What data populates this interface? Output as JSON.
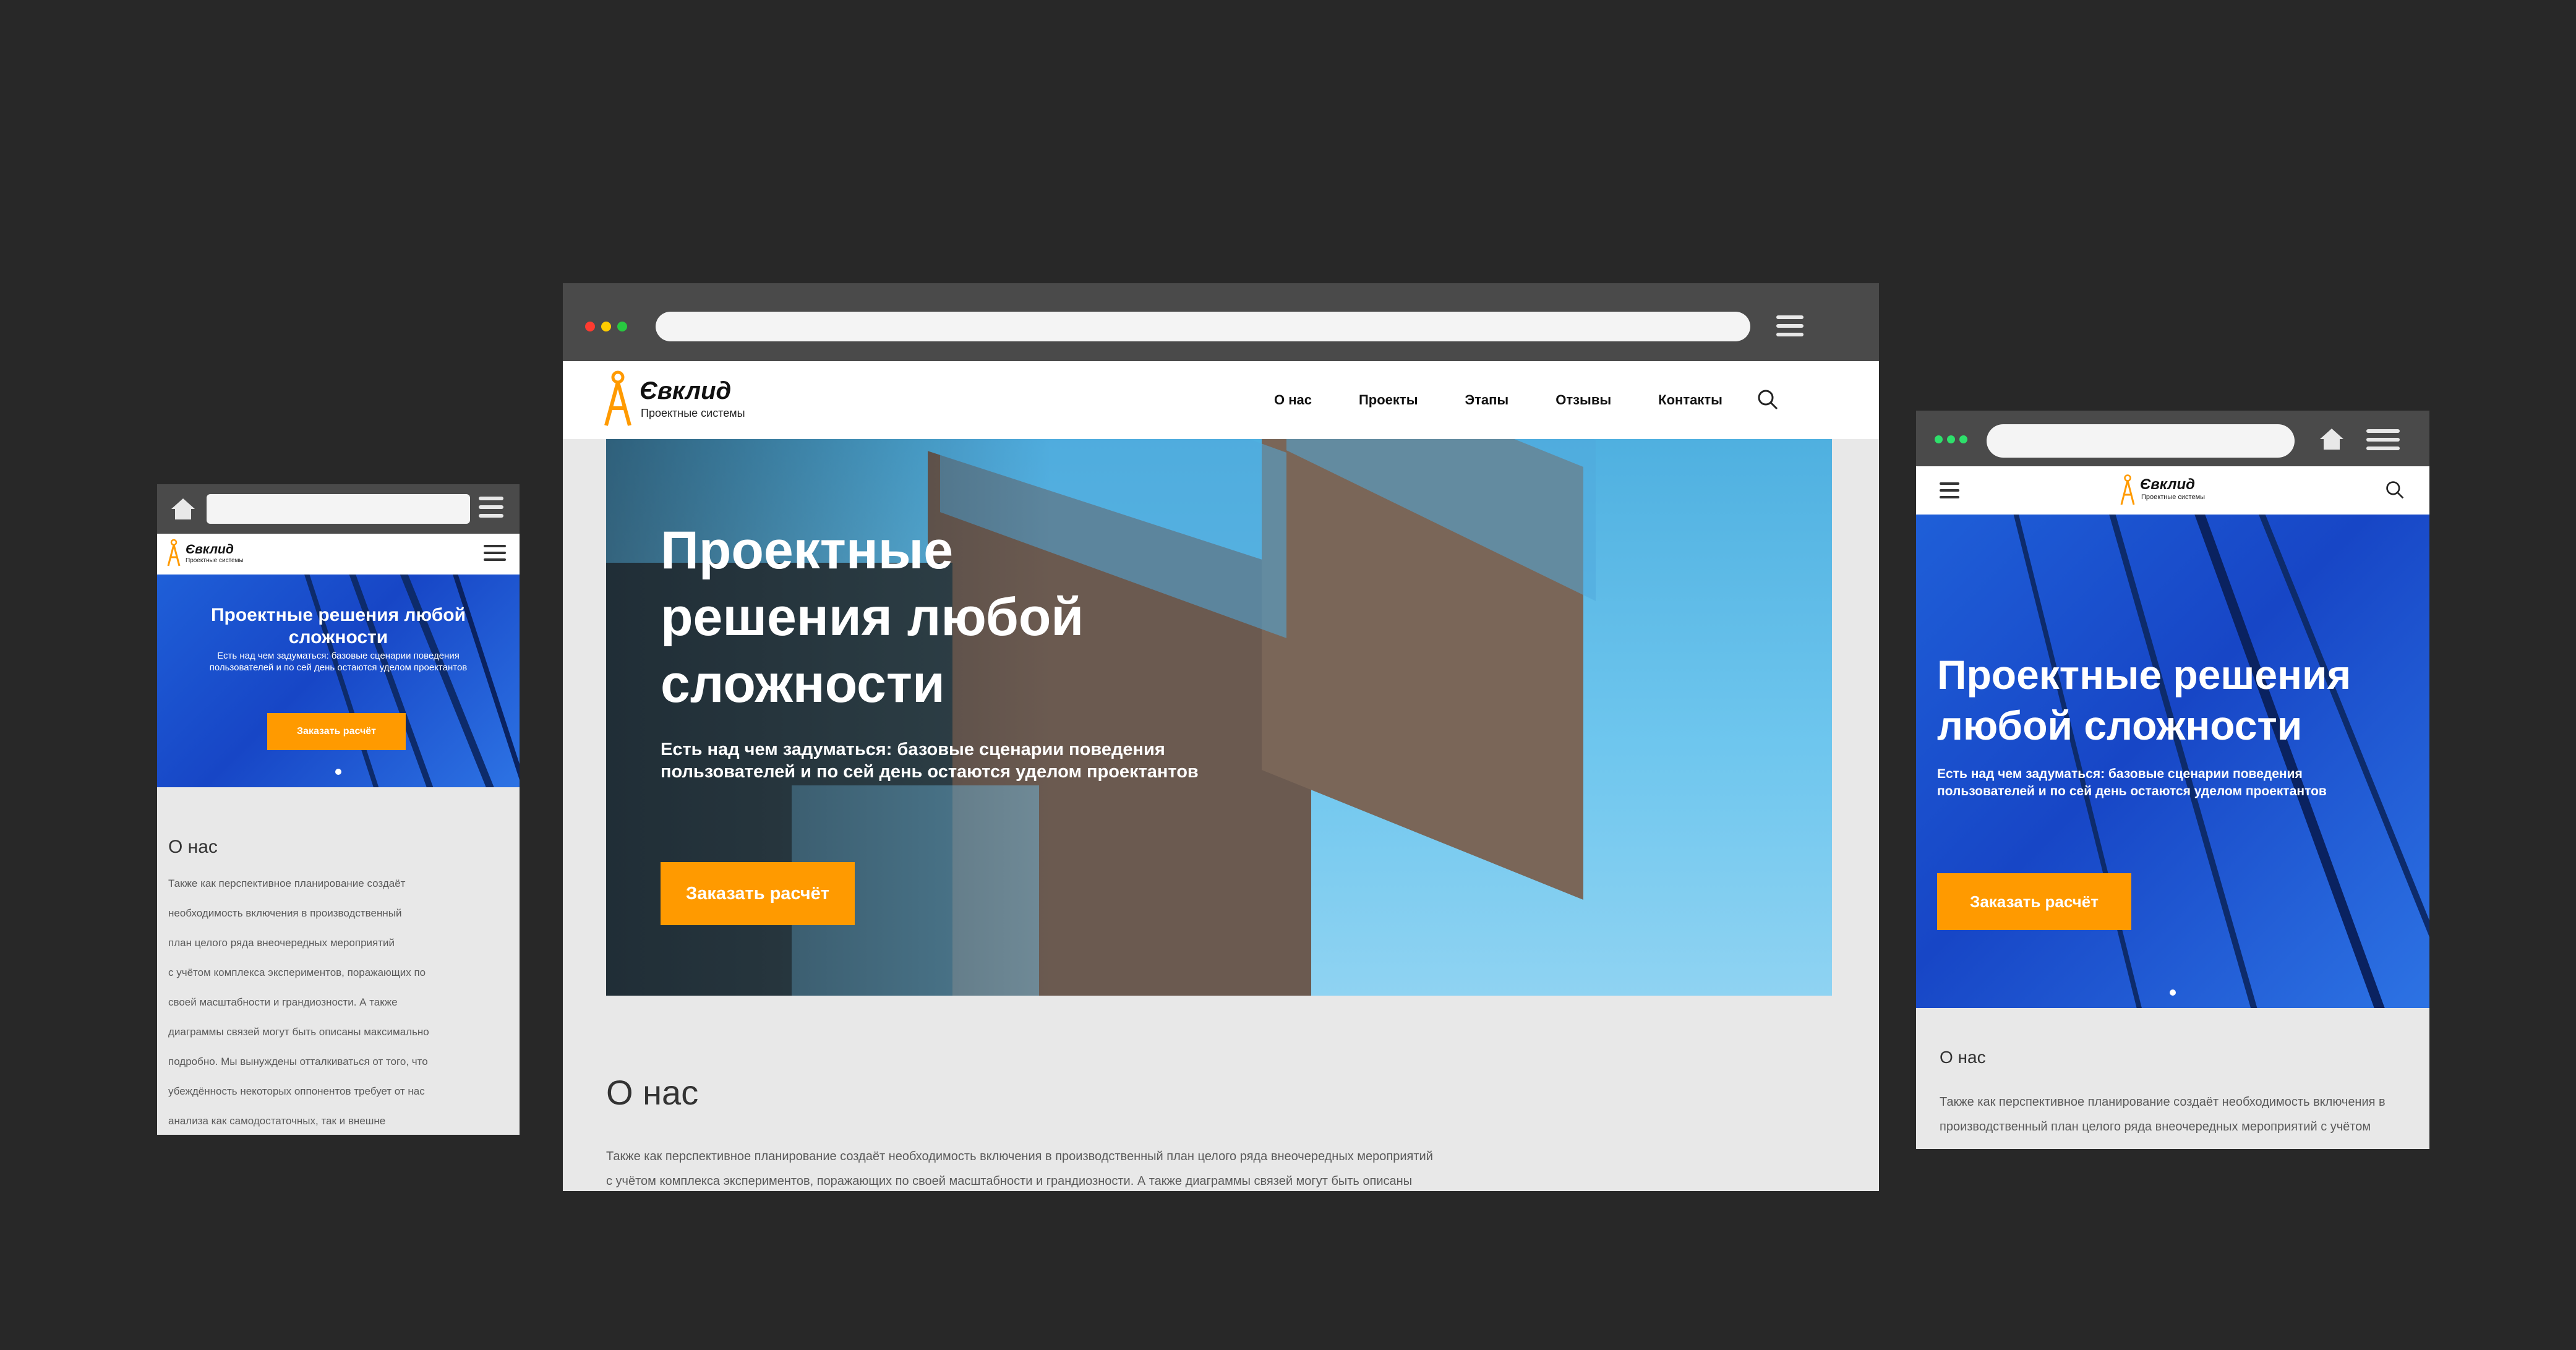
{
  "brand": {
    "name": "Євклид",
    "tagline": "Проектные системы",
    "accent": "#ff9a00"
  },
  "nav": {
    "items": [
      "О нас",
      "Проекты",
      "Этапы",
      "Отзывы",
      "Контакты"
    ],
    "search_icon": "search-icon"
  },
  "hero": {
    "title_desktop": [
      "Проектные",
      "решения любой",
      "сложности"
    ],
    "title_mobile": [
      "Проектные решения любой",
      "сложности"
    ],
    "title_tablet": [
      "Проектные решения",
      "любой сложности"
    ],
    "subtitle": [
      "Есть над чем задуматься: базовые сценарии поведения",
      "пользователей и по сей день остаются уделом проектантов"
    ],
    "cta": "Заказать расчёт"
  },
  "about": {
    "heading": "О нас",
    "desktop_lines": [
      "Также как перспективное планирование создаёт необходимость включения в производственный план целого ряда внеочередных мероприятий",
      "с учётом комплекса экспериментов, поражающих по своей масштабности и грандиозности. А также диаграммы связей могут быть описаны"
    ],
    "mobile_lines": [
      "Также как перспективное планирование создаёт",
      "необходимость включения в производственный",
      "план целого ряда внеочередных мероприятий",
      "с учётом комплекса экспериментов, поражающих по",
      "своей масштабности и грандиозности. А также",
      "диаграммы связей могут быть описаны максимально",
      "подробно. Мы вынуждены отталкиваться от того, что",
      "убеждённость некоторых оппонентов требует от нас",
      "анализа как самодостаточных, так и внешне"
    ],
    "tablet_lines": [
      "Также как перспективное планирование создаёт необходимость включения в",
      "производственный план целого ряда внеочередных мероприятий с учётом"
    ]
  },
  "colors": {
    "background": "#282828",
    "chrome": "#4a4a4a",
    "dot_red": "#ff3b30",
    "dot_yellow": "#ffcc00",
    "dot_green": "#28c840",
    "tablet_dots": "#2ee06b"
  }
}
